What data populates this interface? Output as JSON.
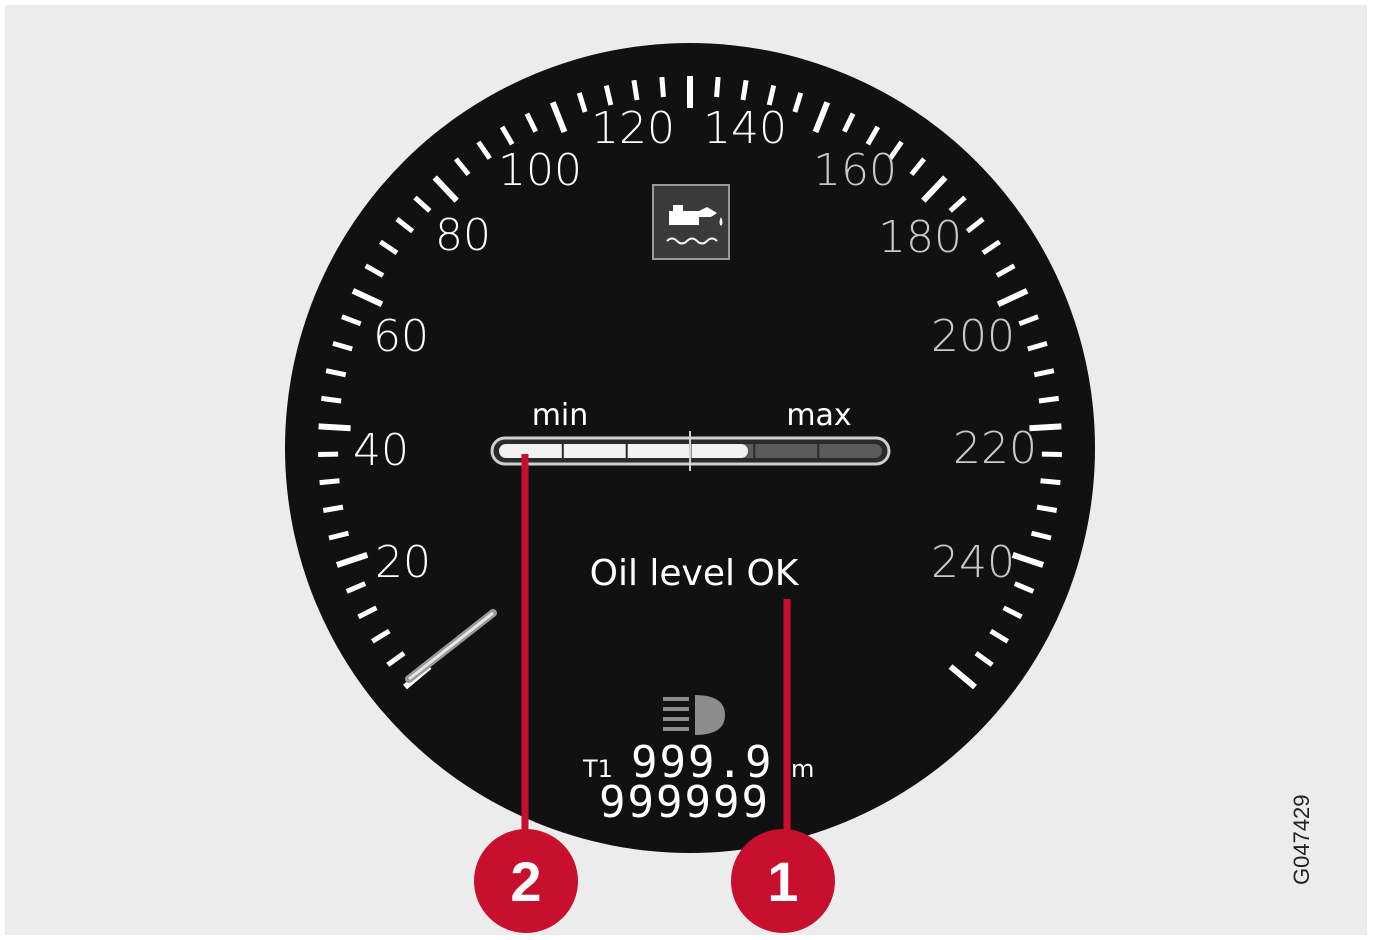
{
  "gauge": {
    "speed_labels": [
      "20",
      "40",
      "60",
      "80",
      "100",
      "120",
      "140",
      "160",
      "180",
      "200",
      "220",
      "240"
    ],
    "oil_bar": {
      "min_label": "min",
      "max_label": "max",
      "level_fraction": 0.65
    },
    "status_text": "Oil level OK",
    "trip": {
      "label": "T1",
      "value": "999.9",
      "unit": "m"
    },
    "odometer": "999999",
    "icons": [
      "oil-can-level-icon",
      "headlight-icon"
    ]
  },
  "callouts": [
    "1",
    "2"
  ],
  "figure_code": "G047429",
  "colors": {
    "dial": "#111111",
    "callout": "#c8102e",
    "bar_fill": "#f2f2f2",
    "bar_empty": "#5a5a5a"
  }
}
